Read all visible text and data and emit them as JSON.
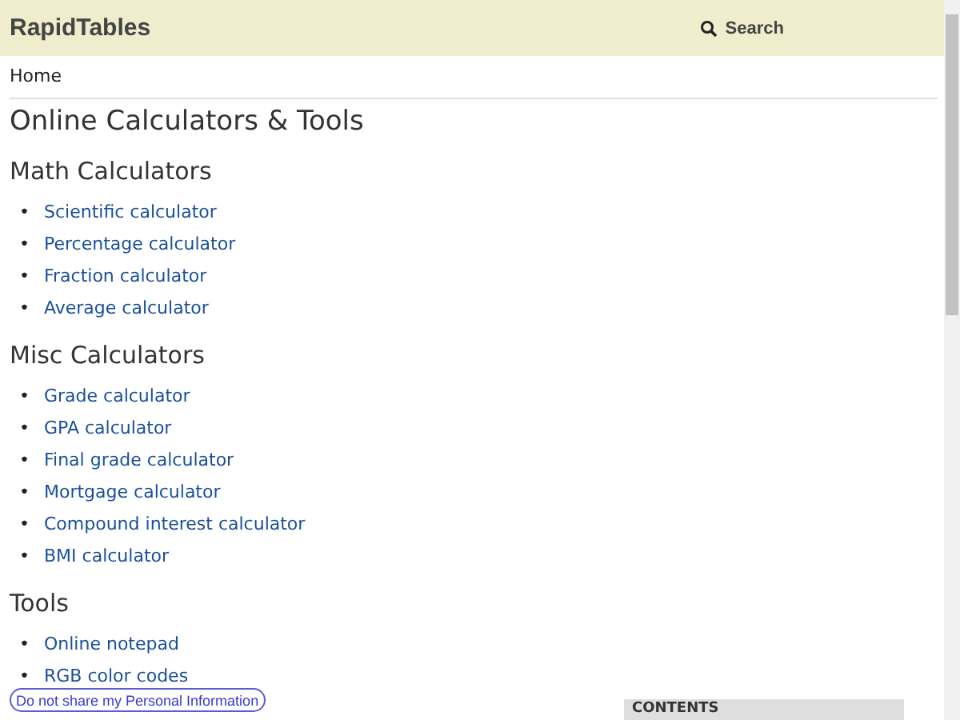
{
  "header": {
    "logo": "RapidTables",
    "search_label": "Search"
  },
  "breadcrumb": "Home",
  "title": "Online Calculators & Tools",
  "sections": [
    {
      "heading": "Math Calculators",
      "links": [
        {
          "bullet": "•",
          "label": "Scientific calculator"
        },
        {
          "bullet": "•",
          "label": "Percentage calculator"
        },
        {
          "bullet": "•",
          "label": "Fraction calculator"
        },
        {
          "bullet": "•",
          "label": "Average calculator"
        }
      ]
    },
    {
      "heading": "Misc Calculators",
      "links": [
        {
          "bullet": "•",
          "label": "Grade calculator"
        },
        {
          "bullet": "•",
          "label": "GPA calculator"
        },
        {
          "bullet": "•",
          "label": "Final grade calculator"
        },
        {
          "bullet": "•",
          "label": "Mortgage calculator"
        },
        {
          "bullet": "•",
          "label": "Compound interest calculator"
        },
        {
          "bullet": "•",
          "label": "BMI calculator"
        }
      ]
    },
    {
      "heading": "Tools",
      "links": [
        {
          "bullet": "•",
          "label": "Online notepad"
        },
        {
          "bullet": "•",
          "label": "RGB color codes"
        }
      ]
    }
  ],
  "contents_box": {
    "title": "CONTENTS"
  },
  "privacy_button": "Do not share my Personal Information"
}
